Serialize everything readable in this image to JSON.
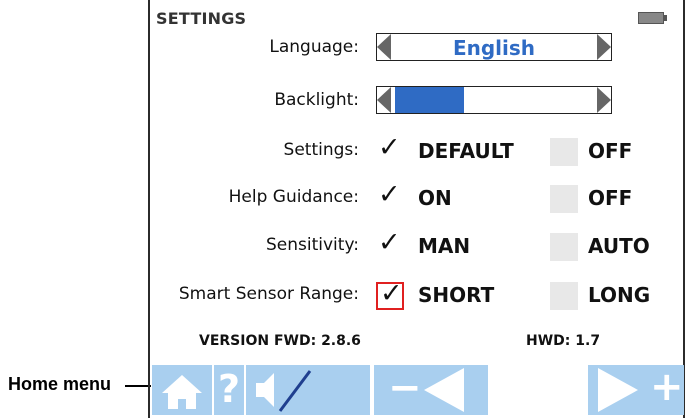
{
  "callout": {
    "label": "Home menu"
  },
  "header": {
    "title": "SETTINGS",
    "battery_icon": "battery-icon"
  },
  "settings": {
    "language": {
      "label": "Language:",
      "value": "English"
    },
    "backlight": {
      "label": "Backlight:",
      "level_fraction": 0.35
    },
    "rows": [
      {
        "label": "Settings:",
        "option_a": "DEFAULT",
        "option_b": "OFF",
        "selected": "a"
      },
      {
        "label": "Help Guidance:",
        "option_a": "ON",
        "option_b": "OFF",
        "selected": "a"
      },
      {
        "label": "Sensitivity:",
        "option_a": "MAN",
        "option_b": "AUTO",
        "selected": "a"
      },
      {
        "label": "Smart Sensor Range:",
        "option_a": "SHORT",
        "option_b": "LONG",
        "selected": "a"
      }
    ]
  },
  "version": {
    "fwd": "VERSION FWD: 2.8.6",
    "hwd": "HWD: 1.7"
  },
  "toolbar": {
    "home_icon": "home-icon",
    "help_label": "?",
    "mute_icon": "speaker-mute-icon",
    "minus_label": "−",
    "plus_label": "+"
  },
  "colors": {
    "accent": "#2f6bc4",
    "toolbar": "#a9cfef",
    "focus": "#e02020"
  }
}
